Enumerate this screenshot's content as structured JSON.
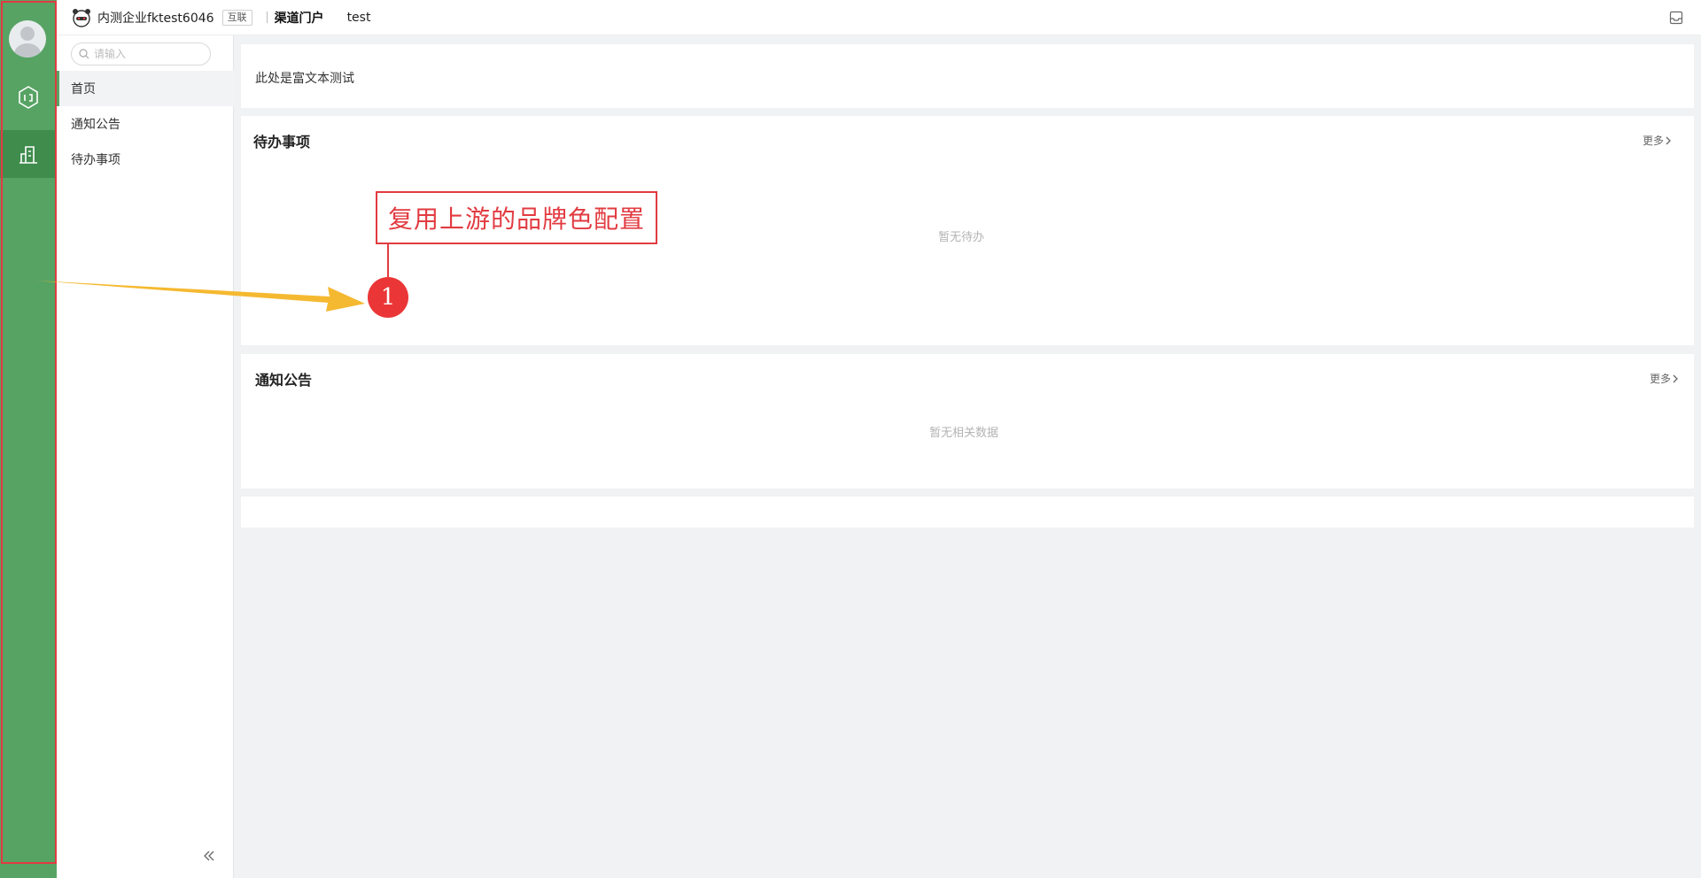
{
  "rail": {
    "icons": [
      "avatar",
      "apps-hexagon-icon",
      "building-chart-icon"
    ]
  },
  "header": {
    "company": "内测企业fktest6046",
    "tag": "互联",
    "portal": "渠道门户",
    "user": "test"
  },
  "sidebar": {
    "search_placeholder": "请输入",
    "items": [
      {
        "label": "首页"
      },
      {
        "label": "通知公告"
      },
      {
        "label": "待办事项"
      }
    ]
  },
  "main": {
    "rich_text": "此处是富文本测试",
    "todo": {
      "title": "待办事项",
      "more": "更多",
      "empty": "暂无待办"
    },
    "notice": {
      "title": "通知公告",
      "more": "更多",
      "empty": "暂无相关数据"
    }
  },
  "annotation": {
    "text": "复用上游的品牌色配置",
    "badge": "1"
  },
  "colors": {
    "brand": "#57a364",
    "annotation_red": "#e23b41",
    "arrow": "#f5b931"
  }
}
